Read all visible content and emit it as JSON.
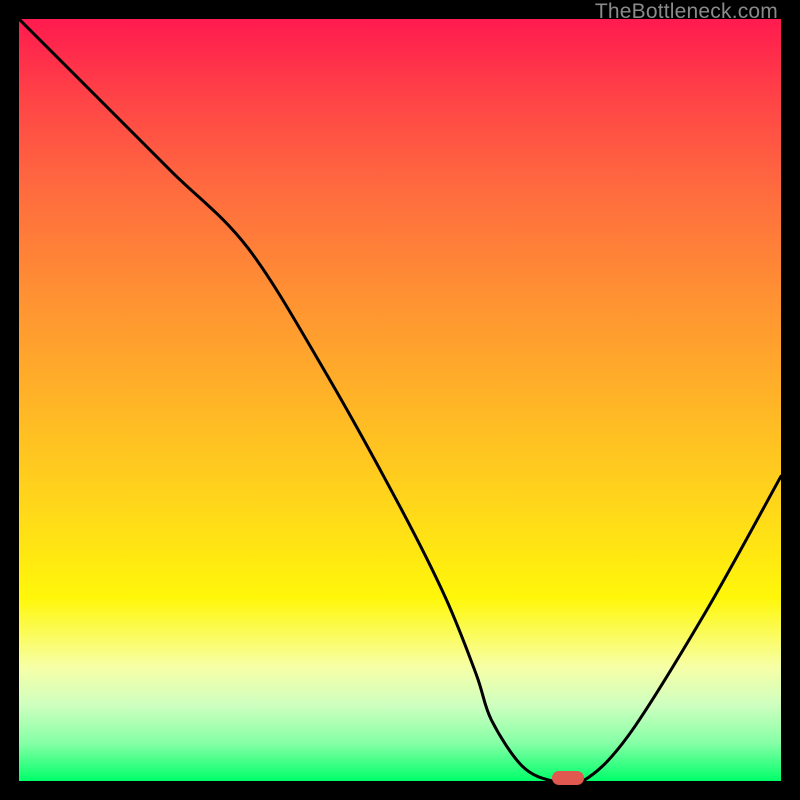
{
  "watermark": "TheBottleneck.com",
  "chart_data": {
    "type": "line",
    "title": "",
    "xlabel": "",
    "ylabel": "",
    "xlim": [
      0,
      100
    ],
    "ylim": [
      0,
      100
    ],
    "grid": false,
    "legend": false,
    "series": [
      {
        "name": "bottleneck-curve",
        "x": [
          0,
          10,
          20,
          30,
          40,
          50,
          56,
          60,
          62,
          66,
          70,
          74,
          80,
          90,
          100
        ],
        "y": [
          100,
          90,
          80,
          70,
          54,
          36,
          24,
          14,
          8,
          2,
          0,
          0,
          6,
          22,
          40
        ]
      }
    ],
    "marker": {
      "x": 72,
      "y": 0,
      "color": "#e0584f"
    },
    "gradient_stops": [
      {
        "pos": 0.0,
        "color": "#ff1a4f"
      },
      {
        "pos": 0.1,
        "color": "#ff4247"
      },
      {
        "pos": 0.22,
        "color": "#ff6a3f"
      },
      {
        "pos": 0.36,
        "color": "#ff9033"
      },
      {
        "pos": 0.5,
        "color": "#ffb427"
      },
      {
        "pos": 0.64,
        "color": "#ffd71a"
      },
      {
        "pos": 0.76,
        "color": "#fff70a"
      },
      {
        "pos": 0.85,
        "color": "#f7ffa6"
      },
      {
        "pos": 0.9,
        "color": "#cfffc0"
      },
      {
        "pos": 0.95,
        "color": "#86ffa6"
      },
      {
        "pos": 1.0,
        "color": "#00ff6a"
      }
    ]
  }
}
